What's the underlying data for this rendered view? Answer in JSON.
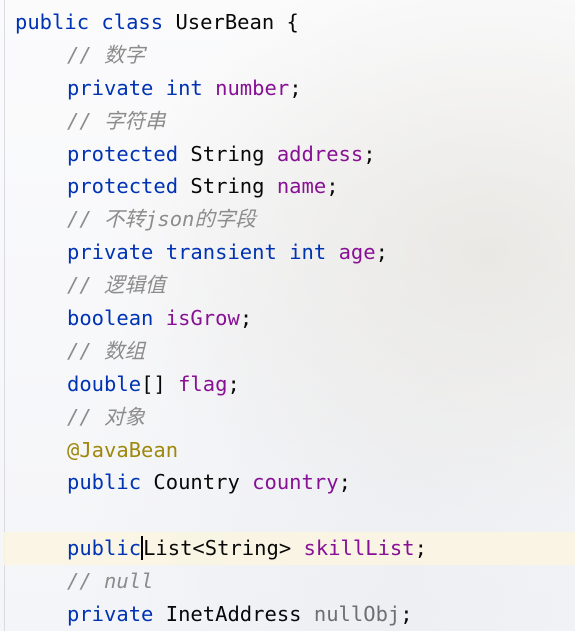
{
  "code_lines": [
    {
      "tokens": [
        "public",
        " ",
        "class",
        " UserBean {"
      ]
    },
    {
      "tokens": [
        "// 数字"
      ]
    },
    {
      "tokens": [
        "private",
        " ",
        "int",
        " ",
        "number",
        ";"
      ]
    },
    {
      "tokens": [
        "// 字符串"
      ]
    },
    {
      "tokens": [
        "protected",
        " String ",
        "address",
        ";"
      ]
    },
    {
      "tokens": [
        "protected",
        " String ",
        "name",
        ";"
      ]
    },
    {
      "tokens": [
        "// 不转json的字段"
      ]
    },
    {
      "tokens": [
        "private",
        " ",
        "transient",
        " ",
        "int",
        " ",
        "age",
        ";"
      ]
    },
    {
      "tokens": [
        "// 逻辑值"
      ]
    },
    {
      "tokens": [
        "boolean",
        " ",
        "isGrow",
        ";"
      ]
    },
    {
      "tokens": [
        "// 数组"
      ]
    },
    {
      "tokens": [
        "double",
        "[] ",
        "flag",
        ";"
      ]
    },
    {
      "tokens": [
        "// 对象"
      ]
    },
    {
      "tokens": [
        "@JavaBean"
      ]
    },
    {
      "tokens": [
        "public",
        " Country ",
        "country",
        ";"
      ]
    },
    {
      "tokens": [
        ""
      ]
    },
    {
      "tokens": [
        "public",
        "List<String> ",
        "skillList",
        ";"
      ]
    },
    {
      "tokens": [
        "// null"
      ]
    },
    {
      "tokens": [
        "private",
        " InetAddress ",
        "nullObj",
        ";"
      ]
    }
  ]
}
